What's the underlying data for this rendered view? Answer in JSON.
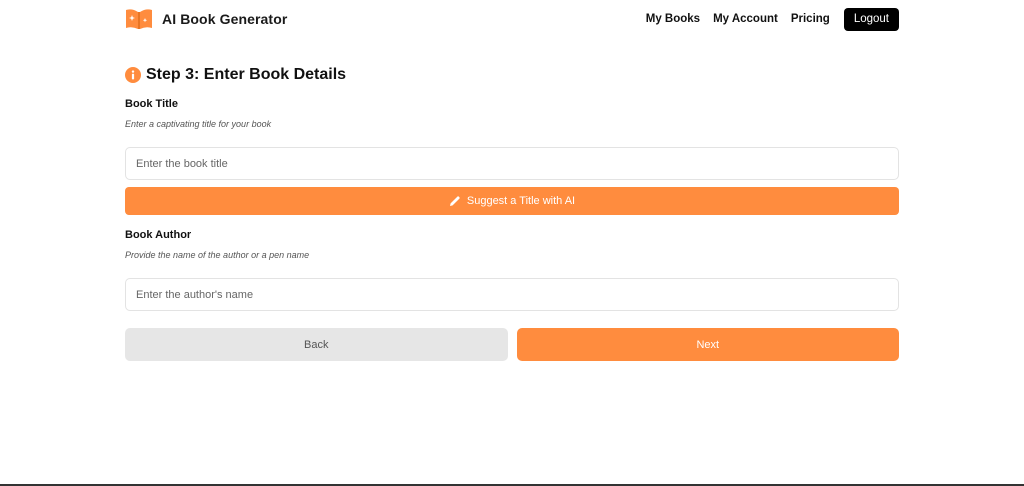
{
  "app": {
    "brand_name": "AI Book Generator",
    "brand_icon": "open-book-sparkle-icon",
    "accent_color": "#ff8c3e"
  },
  "nav": {
    "links": [
      {
        "label": "My Books"
      },
      {
        "label": "My Account"
      },
      {
        "label": "Pricing"
      }
    ],
    "logout_label": "Logout"
  },
  "step": {
    "icon": "info-icon",
    "title": "Step 3: Enter Book Details"
  },
  "book_title": {
    "label": "Book Title",
    "hint": "Enter a captivating title for your book",
    "value": "",
    "placeholder": "Enter the book title"
  },
  "suggest": {
    "icon": "pencil-icon",
    "label": "Suggest a Title with AI"
  },
  "book_author": {
    "label": "Book Author",
    "hint": "Provide the name of the author or a pen name",
    "value": "",
    "placeholder": "Enter the author's name"
  },
  "actions": {
    "back_label": "Back",
    "next_label": "Next"
  }
}
